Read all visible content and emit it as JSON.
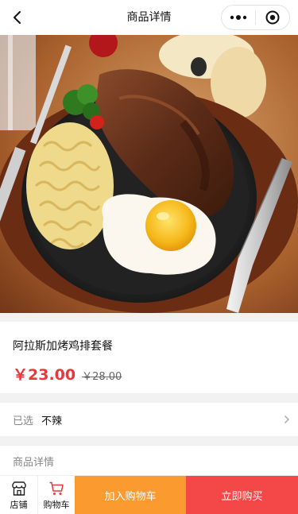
{
  "navbar": {
    "title": "商品详情"
  },
  "product": {
    "name": "阿拉斯加烤鸡排套餐",
    "price": "￥23.00",
    "original_price": "￥28.00",
    "image_icon": "steak-plate-image"
  },
  "spec": {
    "label": "已选",
    "value": "不辣"
  },
  "detail": {
    "title": "商品详情"
  },
  "bottom_bar": {
    "store_label": "店铺",
    "cart_label": "购物车",
    "add_to_cart": "加入购物车",
    "buy_now": "立即购买"
  },
  "colors": {
    "price": "#e5393b",
    "add_to_cart_bg": "#fb9a2f",
    "buy_now_bg": "#f44848",
    "cart_icon": "#e5393b"
  }
}
